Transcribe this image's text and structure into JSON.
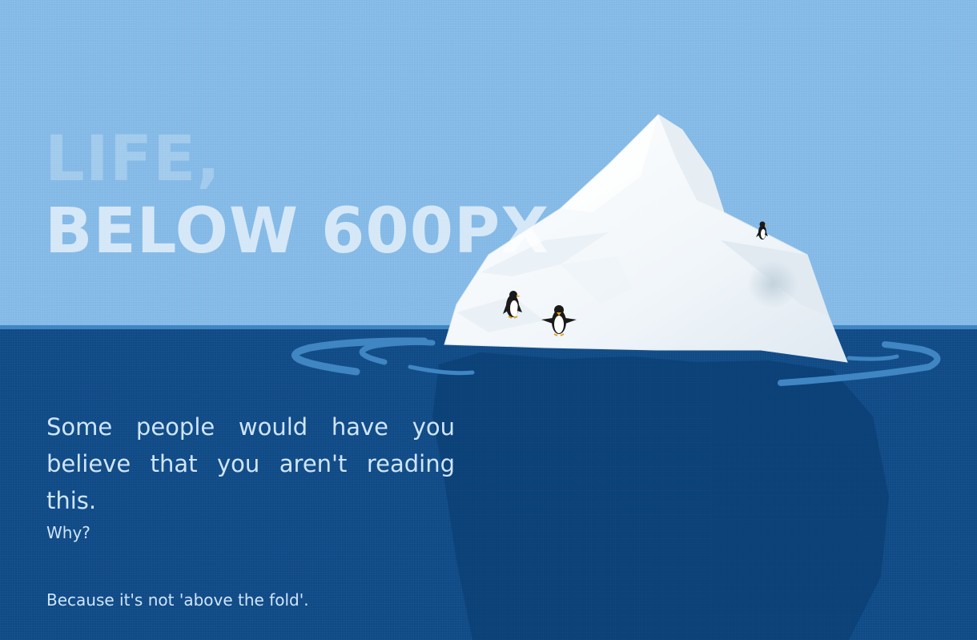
{
  "headline": {
    "line1": "LIFE,",
    "line2": "BELOW 600PX"
  },
  "body": {
    "intro": "Some people would have you believe that you aren't reading this.",
    "question": "Why?",
    "answer": "Because it's not 'above the fold'."
  },
  "colors": {
    "sky": "#82b8e6",
    "sea": "#0f4a86",
    "waterline": "#3f86c3",
    "iceberg": "#f4f8fb",
    "text": "#cfe5fa"
  },
  "illustration": {
    "iceberg_icon": "iceberg-icon",
    "penguin_icon": "penguin-icon",
    "penguin_count": 3
  }
}
